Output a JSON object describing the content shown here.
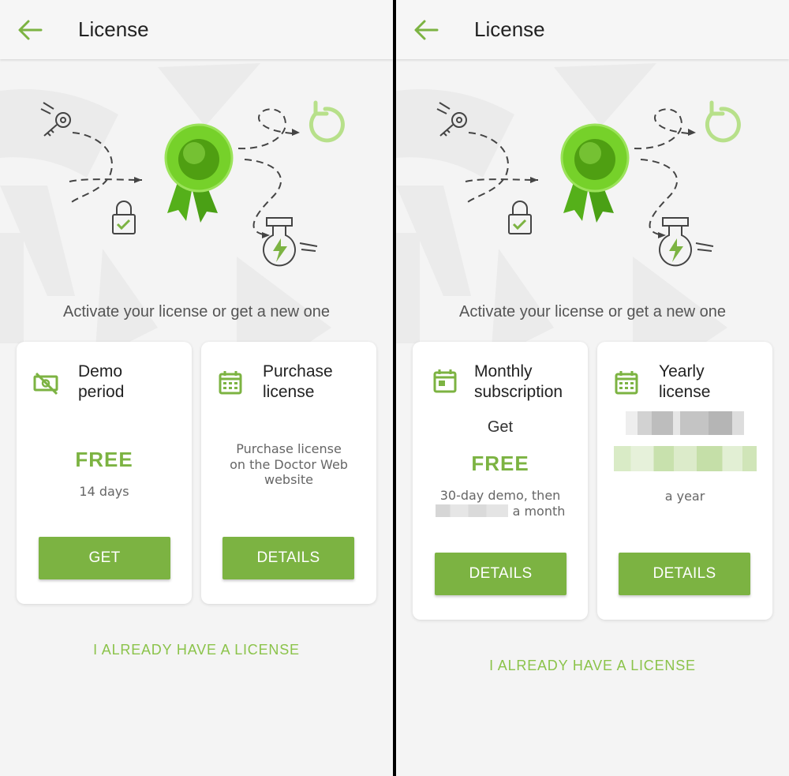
{
  "screens": [
    {
      "title": "License",
      "subtitle": "Activate your license or get a new one",
      "cards": [
        {
          "title_line1": "Demo",
          "title_line2": "period",
          "icon": "no-money-icon",
          "price": "FREE",
          "detail": "14 days",
          "button": "GET"
        },
        {
          "title_line1": "Purchase",
          "title_line2": "license",
          "icon": "calendar-icon",
          "desc_line1": "Purchase license",
          "desc_line2": "on the Doctor Web",
          "desc_line3": "website",
          "button": "DETAILS"
        }
      ],
      "link": "I ALREADY HAVE A LICENSE"
    },
    {
      "title": "License",
      "subtitle": "Activate your license or get a new one",
      "cards": [
        {
          "title_line1": "Monthly",
          "title_line2": "subscription",
          "icon": "calendar-icon",
          "get": "Get",
          "price": "FREE",
          "desc_line1": "30-day demo, then",
          "desc_line2_suffix": "a month",
          "button": "DETAILS"
        },
        {
          "title_line1": "Yearly",
          "title_line2": "license",
          "icon": "calendar-icon",
          "period": "a year",
          "button": "DETAILS"
        }
      ],
      "link": "I ALREADY HAVE A LICENSE"
    }
  ],
  "colors": {
    "accent": "#7cb342",
    "link": "#8bc34a",
    "background": "#f4f4f4"
  }
}
